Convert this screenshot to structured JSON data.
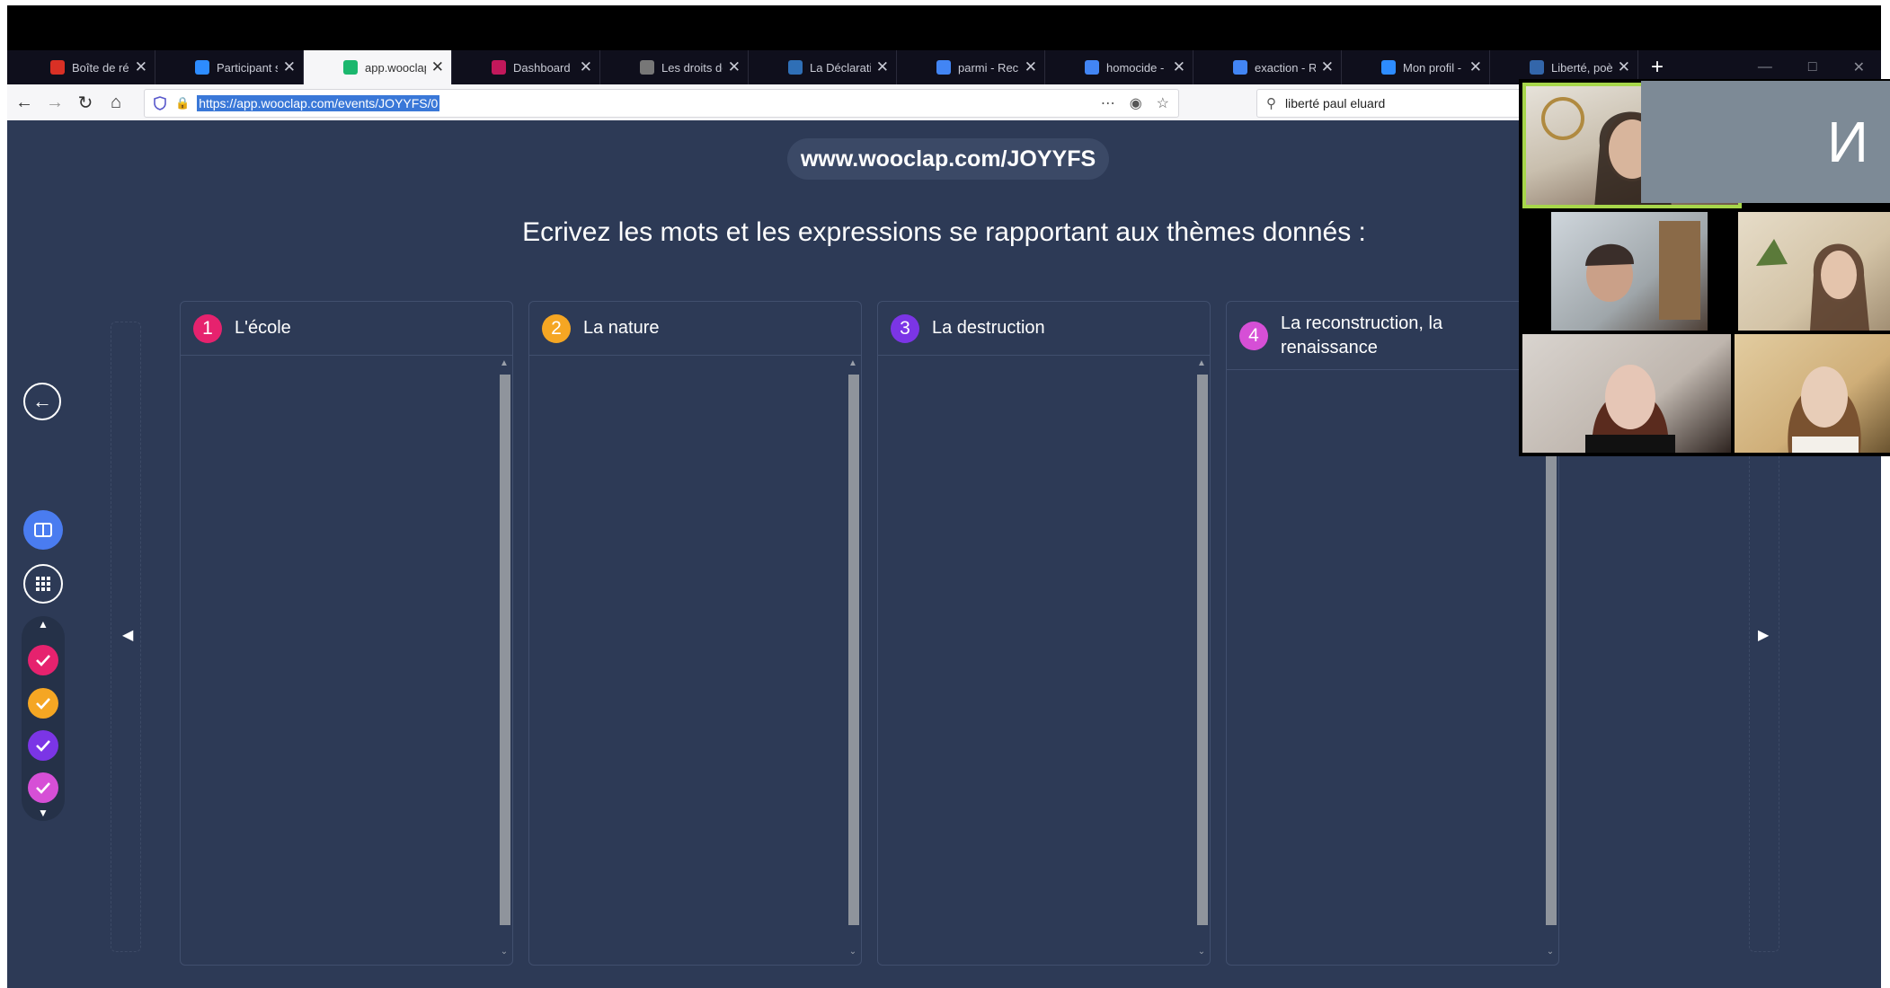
{
  "browser": {
    "tabs": [
      {
        "label": "Boîte de réceptio",
        "favicon": "gmail-icon",
        "color": "#d93025"
      },
      {
        "label": "Participant sortan",
        "favicon": "zoom-icon",
        "color": "#2d8cff"
      },
      {
        "label": "app.wooclap.com",
        "favicon": "wooclap-icon",
        "color": "#1bb76e",
        "active": true
      },
      {
        "label": "Dashboard",
        "favicon": "dashboard-icon",
        "color": "#c2185b"
      },
      {
        "label": "Les droits de l'ho",
        "favicon": "scales-icon",
        "color": "#777777"
      },
      {
        "label": "La Déclaration u",
        "favicon": "document-icon",
        "color": "#2f6fb6"
      },
      {
        "label": "parmi - Recherch",
        "favicon": "google-icon",
        "color": "#4285f4"
      },
      {
        "label": "homocide - Rech",
        "favicon": "google-icon",
        "color": "#4285f4"
      },
      {
        "label": "exaction - Reche",
        "favicon": "google-icon",
        "color": "#4285f4"
      },
      {
        "label": "Mon profil - Zoo",
        "favicon": "zoom-icon",
        "color": "#2d8cff"
      },
      {
        "label": "Liberté, poème d",
        "favicon": "page-icon",
        "color": "#3366aa"
      }
    ],
    "url": "https://app.wooclap.com/events/JOYYFS/0",
    "search_value": "liberté paul eluard"
  },
  "app": {
    "event_url": "www.wooclap.com/JOYYFS",
    "question": "Ecrivez les mots et les expressions se rapportant aux thèmes donnés :",
    "columns": [
      {
        "number": "1",
        "title": "L'école",
        "color": "#e6226e"
      },
      {
        "number": "2",
        "title": "La nature",
        "color": "#f5a623"
      },
      {
        "number": "3",
        "title": "La destruction",
        "color": "#7b35e6"
      },
      {
        "number": "4",
        "title": "La reconstruction, la renaissance",
        "color": "#d64fd6"
      }
    ],
    "question_checks": [
      {
        "color": "#e6226e"
      },
      {
        "color": "#f5a623"
      },
      {
        "color": "#7b35e6"
      },
      {
        "color": "#d64fd6"
      }
    ]
  },
  "video": {
    "initial_tile": "И"
  }
}
